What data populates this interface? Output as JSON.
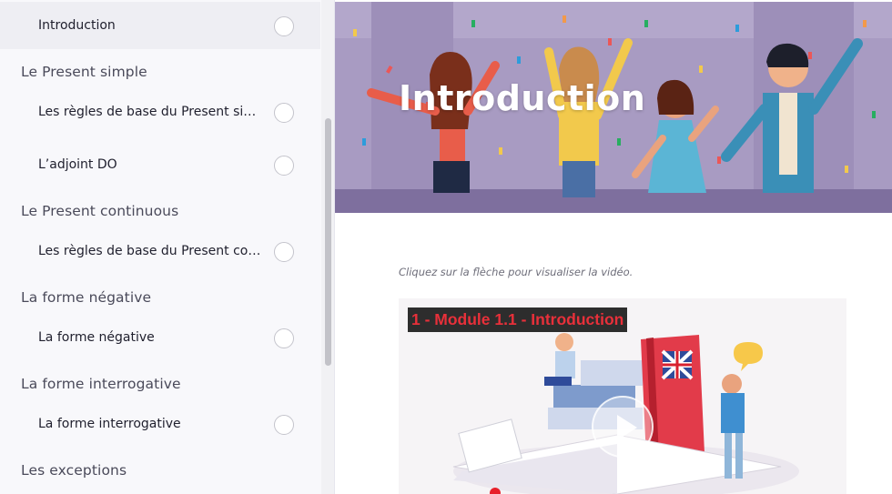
{
  "sidebar": {
    "items": [
      {
        "type": "lesson",
        "label": "Introduction",
        "active": true
      },
      {
        "type": "section",
        "label": "Le Present simple"
      },
      {
        "type": "lesson",
        "label": "Les règles de base du Present sim..."
      },
      {
        "type": "lesson",
        "label": "L’adjoint DO"
      },
      {
        "type": "section",
        "label": "Le Present continuous"
      },
      {
        "type": "lesson",
        "label": "Les règles de base du Present con..."
      },
      {
        "type": "section",
        "label": "La forme négative"
      },
      {
        "type": "lesson",
        "label": "La forme négative"
      },
      {
        "type": "section",
        "label": "La forme interrogative"
      },
      {
        "type": "lesson",
        "label": "La forme interrogative"
      },
      {
        "type": "section",
        "label": "Les exceptions"
      }
    ]
  },
  "main": {
    "banner_title": "Introduction",
    "instruction": "Cliquez sur la flèche pour visualiser la vidéo.",
    "video_title": "1 - Module 1.1 - Introduction"
  },
  "colors": {
    "banner_background": "#a89bc2",
    "video_title_text": "#e8303a",
    "sidebar_background": "#f8f8fb"
  }
}
